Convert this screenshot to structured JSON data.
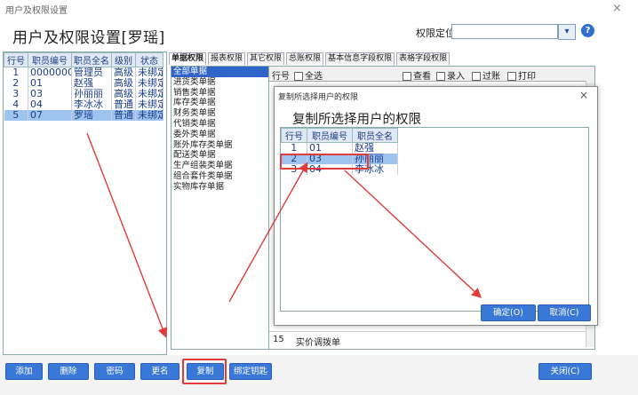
{
  "window": {
    "title": "用户及权限设置",
    "close": "×"
  },
  "page_title": "用户及权限设置[罗瑶]",
  "locate": {
    "label": "权限定位",
    "value": "",
    "search_icon": "search-icon",
    "help_icon": "help-icon"
  },
  "users": {
    "columns": [
      "行号",
      "职员编号",
      "职员全名",
      "级别",
      "状态"
    ],
    "rows": [
      {
        "no": "1",
        "id": "0000000",
        "name": "管理员",
        "level": "高级",
        "status": "未绑定"
      },
      {
        "no": "2",
        "id": "01",
        "name": "赵强",
        "level": "高级",
        "status": "未绑定"
      },
      {
        "no": "3",
        "id": "03",
        "name": "孙丽丽",
        "level": "高级",
        "status": "未绑定"
      },
      {
        "no": "4",
        "id": "04",
        "name": "李冰冰",
        "level": "普通",
        "status": "未绑定"
      },
      {
        "no": "5",
        "id": "07",
        "name": "罗瑶",
        "level": "普通",
        "status": "未绑定"
      }
    ]
  },
  "tabs": [
    "单据权限",
    "报表权限",
    "其它权限",
    "总账权限",
    "基本信息字段权限",
    "表格字段权限"
  ],
  "categories": [
    "全部单据",
    "进货类单据",
    "销售类单据",
    "库存类单据",
    "财务类单据",
    "代销类单据",
    "委外类单据",
    "账外库存类单据",
    "配送类单据",
    "生产组装类单据",
    "组合套件类单据",
    "实物库存单据"
  ],
  "rights": {
    "header": [
      "行号",
      "全选",
      "查看",
      "录入",
      "过账",
      "打印"
    ],
    "last_row": {
      "no": "15",
      "name": "实价调拨单"
    }
  },
  "dialog": {
    "title": "复制所选择用户的权限",
    "heading": "复制所选择用户的权限",
    "columns": [
      "行号",
      "职员编号",
      "职员全名"
    ],
    "rows": [
      {
        "no": "1",
        "id": "01",
        "name": "赵强"
      },
      {
        "no": "2",
        "id": "03",
        "name": "孙丽丽"
      },
      {
        "no": "3",
        "id": "04",
        "name": "李冰冰"
      }
    ],
    "ok": "确定(O)",
    "cancel": "取消(C)"
  },
  "buttons": {
    "add": "添加",
    "delete": "删除",
    "password": "密码",
    "rename": "更名",
    "copy": "复制",
    "bind": "绑定钥匙",
    "close": "关闭(C)"
  },
  "colors": {
    "accent": "#3a78d8",
    "selected_row": "#9ec3ef",
    "highlight": "#e23b3b"
  }
}
